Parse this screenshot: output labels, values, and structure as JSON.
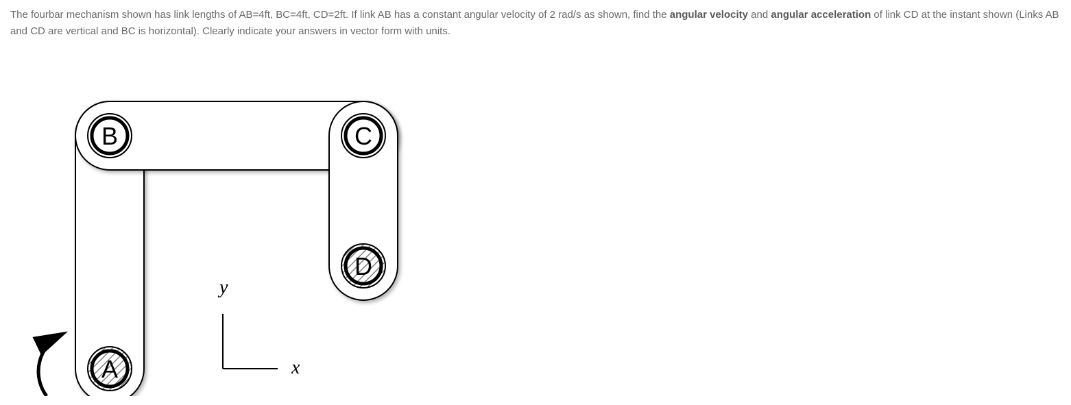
{
  "question": {
    "text_part1": "The fourbar mechanism shown has link lengths of AB=4ft, BC=4ft, CD=2ft.  If link AB has a constant angular velocity of 2 rad/s as shown, find the ",
    "bold1": "angular velocity",
    "text_part2": " and ",
    "bold2": "angular acceleration",
    "text_part3": " of link CD at the instant shown (Links AB and CD are vertical and BC is horizontal).  Clearly indicate your answers in vector form with units."
  },
  "diagram": {
    "joints": {
      "A": "A",
      "B": "B",
      "C": "C",
      "D": "D"
    },
    "axes": {
      "x": "x",
      "y": "y"
    }
  }
}
